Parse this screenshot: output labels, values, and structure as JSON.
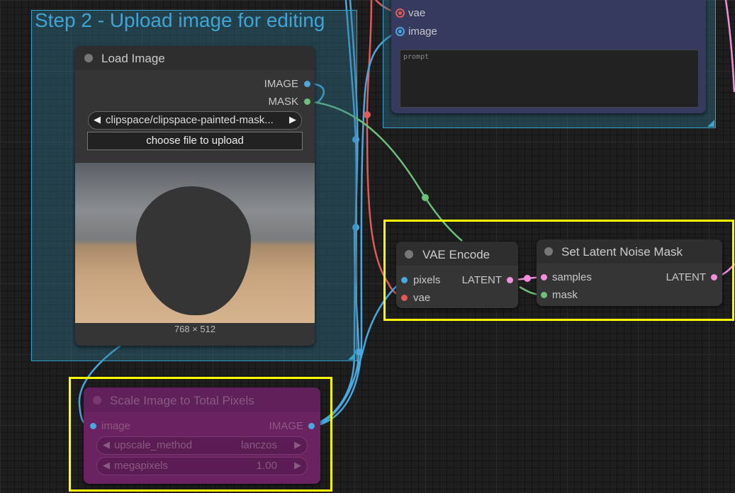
{
  "groups": {
    "upload": {
      "title": "Step 2 - Upload image for editing"
    }
  },
  "top_node": {
    "inputs": [
      "vae",
      "image"
    ],
    "prompt_placeholder": "prompt"
  },
  "load_image": {
    "title": "Load Image",
    "outputs": [
      "IMAGE",
      "MASK"
    ],
    "image_combo": "clipspace/clipspace-painted-mask...",
    "upload_button": "choose file to upload",
    "dimensions": "768 × 512"
  },
  "vae_encode": {
    "title": "VAE Encode",
    "inputs": [
      "pixels",
      "vae"
    ],
    "output": "LATENT"
  },
  "set_latent": {
    "title": "Set Latent Noise Mask",
    "inputs": [
      "samples",
      "mask"
    ],
    "output": "LATENT"
  },
  "scale_image": {
    "title": "Scale Image to Total Pixels",
    "input": "image",
    "output": "IMAGE",
    "widgets": [
      {
        "label": "upscale_method",
        "value": "lanczos"
      },
      {
        "label": "megapixels",
        "value": "1.00"
      }
    ]
  },
  "colors": {
    "image_link": "#4aa8e0",
    "vae_link": "#e05a5a",
    "mask_link": "#6cc07a",
    "latent_link": "#f48fe0",
    "highlight": "#ffff00"
  }
}
